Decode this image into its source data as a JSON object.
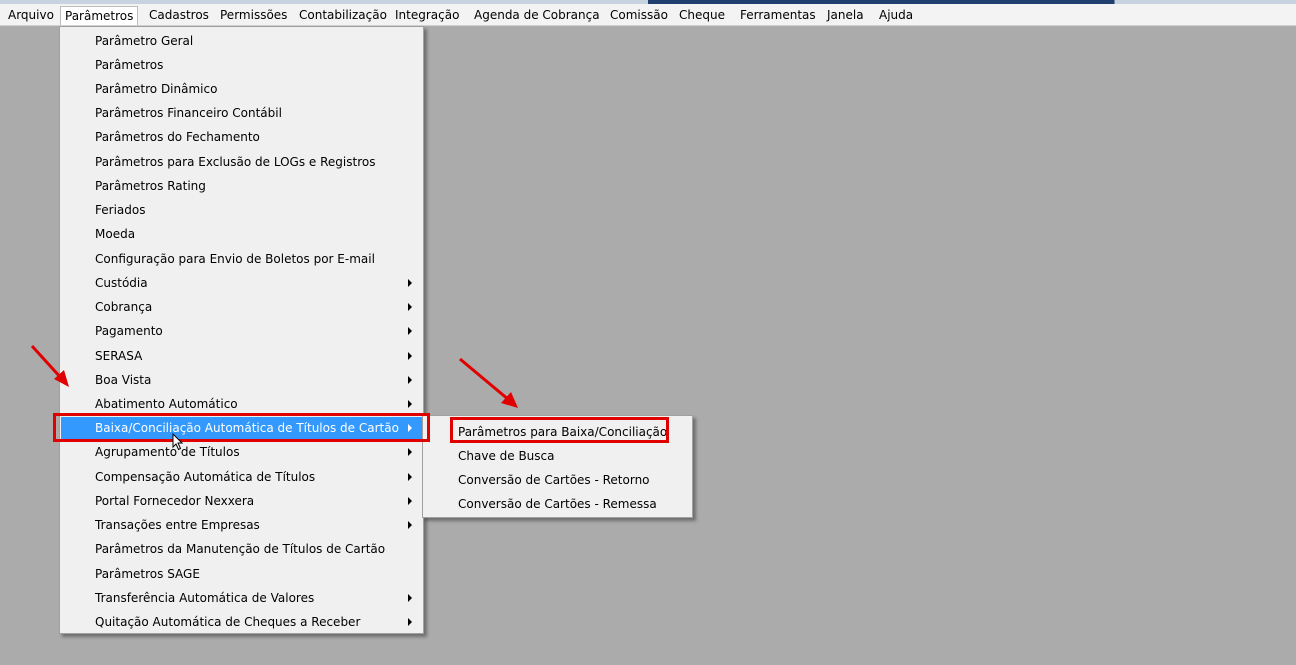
{
  "menubar": {
    "items": [
      "Arquivo",
      "Parâmetros",
      "Cadastros",
      "Permissões",
      "Contabilização",
      "Integração",
      "Agenda de Cobrança",
      "Comissão",
      "Cheque",
      "Ferramentas",
      "Janela",
      "Ajuda"
    ],
    "open_item": "Parâmetros"
  },
  "dropdown": {
    "items": [
      {
        "label": "Parâmetro Geral",
        "has_submenu": false
      },
      {
        "label": "Parâmetros",
        "has_submenu": false
      },
      {
        "label": "Parâmetro Dinâmico",
        "has_submenu": false
      },
      {
        "label": "Parâmetros Financeiro Contábil",
        "has_submenu": false
      },
      {
        "label": "Parâmetros do Fechamento",
        "has_submenu": false
      },
      {
        "label": "Parâmetros para Exclusão de LOGs e Registros",
        "has_submenu": false
      },
      {
        "label": "Parâmetros Rating",
        "has_submenu": false
      },
      {
        "label": "Feriados",
        "has_submenu": false
      },
      {
        "label": "Moeda",
        "has_submenu": false
      },
      {
        "label": "Configuração para Envio de Boletos por E-mail",
        "has_submenu": false
      },
      {
        "label": "Custódia",
        "has_submenu": true
      },
      {
        "label": "Cobrança",
        "has_submenu": true
      },
      {
        "label": "Pagamento",
        "has_submenu": true
      },
      {
        "label": "SERASA",
        "has_submenu": true
      },
      {
        "label": "Boa Vista",
        "has_submenu": true
      },
      {
        "label": "Abatimento Automático",
        "has_submenu": true
      },
      {
        "label": "Baixa/Conciliação Automática de Títulos de Cartão",
        "has_submenu": true,
        "highlighted": true
      },
      {
        "label": "Agrupamento de Títulos",
        "has_submenu": true
      },
      {
        "label": "Compensação Automática de Títulos",
        "has_submenu": true
      },
      {
        "label": "Portal Fornecedor Nexxera",
        "has_submenu": true
      },
      {
        "label": "Transações entre Empresas",
        "has_submenu": true
      },
      {
        "label": "Parâmetros da Manutenção de Títulos de Cartão",
        "has_submenu": false
      },
      {
        "label": "Parâmetros SAGE",
        "has_submenu": false
      },
      {
        "label": "Transferência Automática de Valores",
        "has_submenu": true
      },
      {
        "label": "Quitação Automática de Cheques a Receber",
        "has_submenu": true
      }
    ]
  },
  "submenu": {
    "items": [
      {
        "label": "Parâmetros para Baixa/Conciliação"
      },
      {
        "label": "Chave de Busca"
      },
      {
        "label": "Conversão de Cartões - Retorno"
      },
      {
        "label": "Conversão de Cartões - Remessa"
      }
    ]
  },
  "colors": {
    "workspace": "#ababab",
    "highlight": "#3399ff",
    "annotation": "#e00000"
  }
}
